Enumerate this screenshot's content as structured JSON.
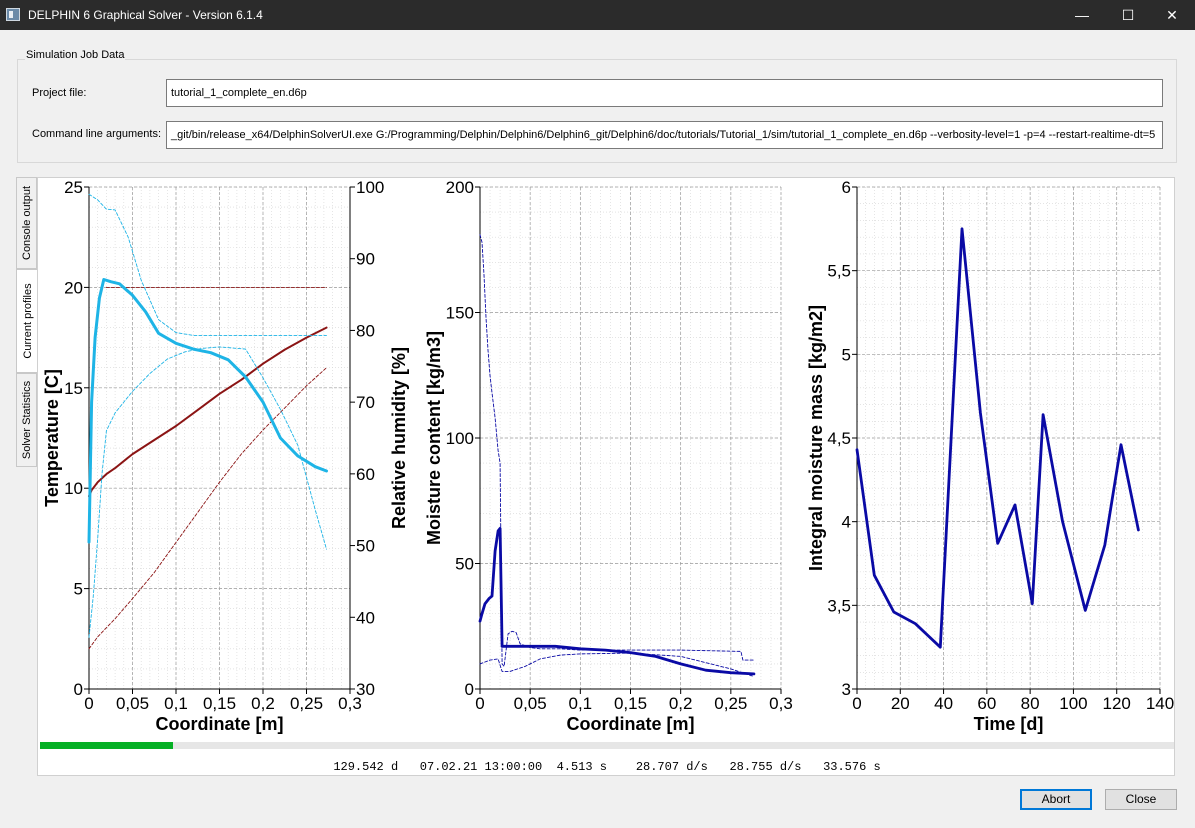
{
  "window": {
    "title": "DELPHIN 6 Graphical Solver - Version 6.1.4",
    "minimize_glyph": "—",
    "maximize_glyph": "☐",
    "close_glyph": "✕"
  },
  "job": {
    "group_title": "Simulation Job Data",
    "project_label": "Project file:",
    "project_value": "tutorial_1_complete_en.d6p",
    "args_label": "Command line arguments:",
    "args_value": "_git/bin/release_x64/DelphinSolverUI.exe G:/Programming/Delphin/Delphin6/Delphin6_git/Delphin6/doc/tutorials/Tutorial_1/sim/tutorial_1_complete_en.d6p  --verbosity-level=1  -p=4  --restart-realtime-dt=5"
  },
  "tabs": [
    {
      "label": "Console output",
      "active": false
    },
    {
      "label": "Current profiles",
      "active": true
    },
    {
      "label": "Solver Statistics",
      "active": false
    }
  ],
  "progress": {
    "fraction": 0.117
  },
  "status": {
    "sim_time": "129.542 d",
    "datetime": "07.02.21 13:00:00",
    "wall_time": "4.513 s",
    "rate1": "28.707 d/s",
    "rate2": "28.755 d/s",
    "total": "33.576 s"
  },
  "buttons": {
    "abort": "Abort",
    "close": "Close"
  },
  "colors": {
    "temperature": "#8b1414",
    "humidity": "#1eb4e6",
    "moisture": "#0a0aa5",
    "progress": "#06b025"
  },
  "chart_data": [
    {
      "type": "line",
      "xlabel": "Coordinate [m]",
      "ylabel": "Temperature [C]",
      "y2label": "Relative humidity [%]",
      "xlim": [
        0,
        0.3
      ],
      "ylim": [
        0,
        25
      ],
      "y2lim": [
        30,
        100
      ],
      "xticks": [
        "0",
        "0,05",
        "0,1",
        "0,15",
        "0,2",
        "0,25",
        "0,3"
      ],
      "yticks": [
        "0",
        "5",
        "10",
        "15",
        "20",
        "25"
      ],
      "y2ticks": [
        "30",
        "40",
        "50",
        "60",
        "70",
        "80",
        "90",
        "100"
      ],
      "grid": true,
      "series": [
        {
          "axis": "y",
          "style": "solid",
          "color": "#8b1414",
          "x": [
            0,
            0.003,
            0.01,
            0.02,
            0.03,
            0.05,
            0.075,
            0.1,
            0.125,
            0.15,
            0.175,
            0.2,
            0.225,
            0.25,
            0.273
          ],
          "y": [
            9.6,
            9.9,
            10.3,
            10.7,
            11.0,
            11.7,
            12.4,
            13.1,
            13.9,
            14.7,
            15.4,
            16.2,
            16.9,
            17.5,
            18.0
          ]
        },
        {
          "axis": "y",
          "style": "dashed",
          "color": "#8b1414",
          "x": [
            0.02,
            0.273
          ],
          "y": [
            20.0,
            20.0
          ]
        },
        {
          "axis": "y",
          "style": "dashed",
          "color": "#8b1414",
          "x": [
            0,
            0.01,
            0.03,
            0.05,
            0.075,
            0.1,
            0.125,
            0.15,
            0.175,
            0.2,
            0.225,
            0.25,
            0.273
          ],
          "y": [
            2.0,
            2.6,
            3.5,
            4.5,
            5.8,
            7.3,
            8.8,
            10.3,
            11.7,
            12.9,
            14.0,
            15.1,
            16.0
          ]
        },
        {
          "axis": "y2",
          "style": "solid",
          "color": "#1eb4e6",
          "x": [
            0,
            0.003,
            0.007,
            0.012,
            0.017,
            0.025,
            0.035,
            0.05,
            0.065,
            0.08,
            0.1,
            0.12,
            0.14,
            0.16,
            0.18,
            0.2,
            0.22,
            0.24,
            0.26,
            0.273
          ],
          "y": [
            50.5,
            70,
            79,
            84.5,
            87.1,
            86.8,
            86.5,
            84.9,
            82.6,
            79.6,
            78.2,
            77.4,
            76.9,
            75.9,
            73.5,
            70.0,
            65.0,
            62.5,
            61.0,
            60.4
          ]
        },
        {
          "axis": "y2",
          "style": "dashed",
          "color": "#1eb4e6",
          "x": [
            0,
            0.01,
            0.02,
            0.03,
            0.045,
            0.06,
            0.08,
            0.1,
            0.12,
            0.15,
            0.2,
            0.25,
            0.273
          ],
          "y": [
            99,
            98.2,
            96.9,
            96.8,
            93,
            87,
            81.5,
            79.7,
            79.3,
            79.3,
            79.3,
            79.3,
            79.3
          ]
        },
        {
          "axis": "y2",
          "style": "dashed",
          "color": "#1eb4e6",
          "x": [
            0,
            0.005,
            0.01,
            0.015,
            0.02,
            0.03,
            0.04,
            0.05,
            0.07,
            0.09,
            0.11,
            0.13,
            0.15,
            0.18,
            0.2,
            0.22,
            0.24,
            0.26,
            0.273
          ],
          "y": [
            37.2,
            43,
            51,
            60,
            66,
            68.5,
            70,
            71.5,
            74,
            76,
            77,
            77.5,
            77.7,
            77.4,
            73.4,
            69,
            64,
            55,
            49.5
          ]
        }
      ]
    },
    {
      "type": "line",
      "xlabel": "Coordinate [m]",
      "ylabel": "Moisture content [kg/m3]",
      "xlim": [
        0,
        0.3
      ],
      "ylim": [
        0,
        200
      ],
      "xticks": [
        "0",
        "0,05",
        "0,1",
        "0,15",
        "0,2",
        "0,25",
        "0,3"
      ],
      "yticks": [
        "0",
        "50",
        "100",
        "150",
        "200"
      ],
      "grid": true,
      "series": [
        {
          "style": "solid",
          "color": "#0a0aa5",
          "x": [
            0,
            0.002,
            0.005,
            0.009,
            0.012,
            0.015,
            0.018,
            0.02,
            0.022,
            0.025,
            0.05,
            0.075,
            0.1,
            0.125,
            0.15,
            0.175,
            0.2,
            0.225,
            0.25,
            0.273
          ],
          "y": [
            27,
            30,
            34,
            36,
            37,
            55,
            63,
            64,
            17,
            17,
            17,
            17,
            16,
            15.5,
            14.5,
            13,
            10,
            7.5,
            6.5,
            6
          ]
        },
        {
          "style": "dashed",
          "color": "#0a0aa5",
          "x": [
            0,
            0.002,
            0.004,
            0.006,
            0.008,
            0.01,
            0.012,
            0.015,
            0.018,
            0.02,
            0.022,
            0.024,
            0.028,
            0.032,
            0.036,
            0.04,
            0.05,
            0.06,
            0.08,
            0.1,
            0.15,
            0.2,
            0.26,
            0.262,
            0.273
          ],
          "y": [
            181,
            178,
            165,
            148,
            135,
            125,
            118,
            108,
            95,
            90,
            10,
            9,
            22,
            23,
            22.5,
            18,
            16.5,
            16,
            16,
            15.5,
            15.5,
            15.5,
            15,
            11.5,
            11.5
          ]
        },
        {
          "style": "dashed",
          "color": "#0a0aa5",
          "x": [
            0,
            0.01,
            0.018,
            0.022,
            0.03,
            0.045,
            0.06,
            0.08,
            0.1,
            0.15,
            0.2,
            0.25,
            0.273
          ],
          "y": [
            10,
            11.5,
            12,
            7,
            7,
            9,
            12,
            13.5,
            14,
            14.3,
            13,
            8,
            5
          ]
        }
      ]
    },
    {
      "type": "line",
      "xlabel": "Time [d]",
      "ylabel": "Integral moisture mass [kg/m2]",
      "xlim": [
        0,
        140
      ],
      "ylim": [
        3,
        6
      ],
      "xticks": [
        "0",
        "20",
        "40",
        "60",
        "80",
        "100",
        "120",
        "140"
      ],
      "yticks": [
        "3",
        "3,5",
        "4",
        "4,5",
        "5",
        "5,5",
        "6"
      ],
      "grid": true,
      "series": [
        {
          "style": "solid",
          "color": "#0a0aa5",
          "x": [
            0,
            8,
            17,
            27,
            38.5,
            48.5,
            57,
            65,
            73,
            81,
            86,
            95,
            105.5,
            114.5,
            122,
            130
          ],
          "y": [
            4.43,
            3.68,
            3.46,
            3.39,
            3.25,
            5.75,
            4.65,
            3.87,
            4.1,
            3.51,
            4.64,
            4.0,
            3.47,
            3.86,
            4.46,
            3.95
          ]
        }
      ]
    }
  ]
}
